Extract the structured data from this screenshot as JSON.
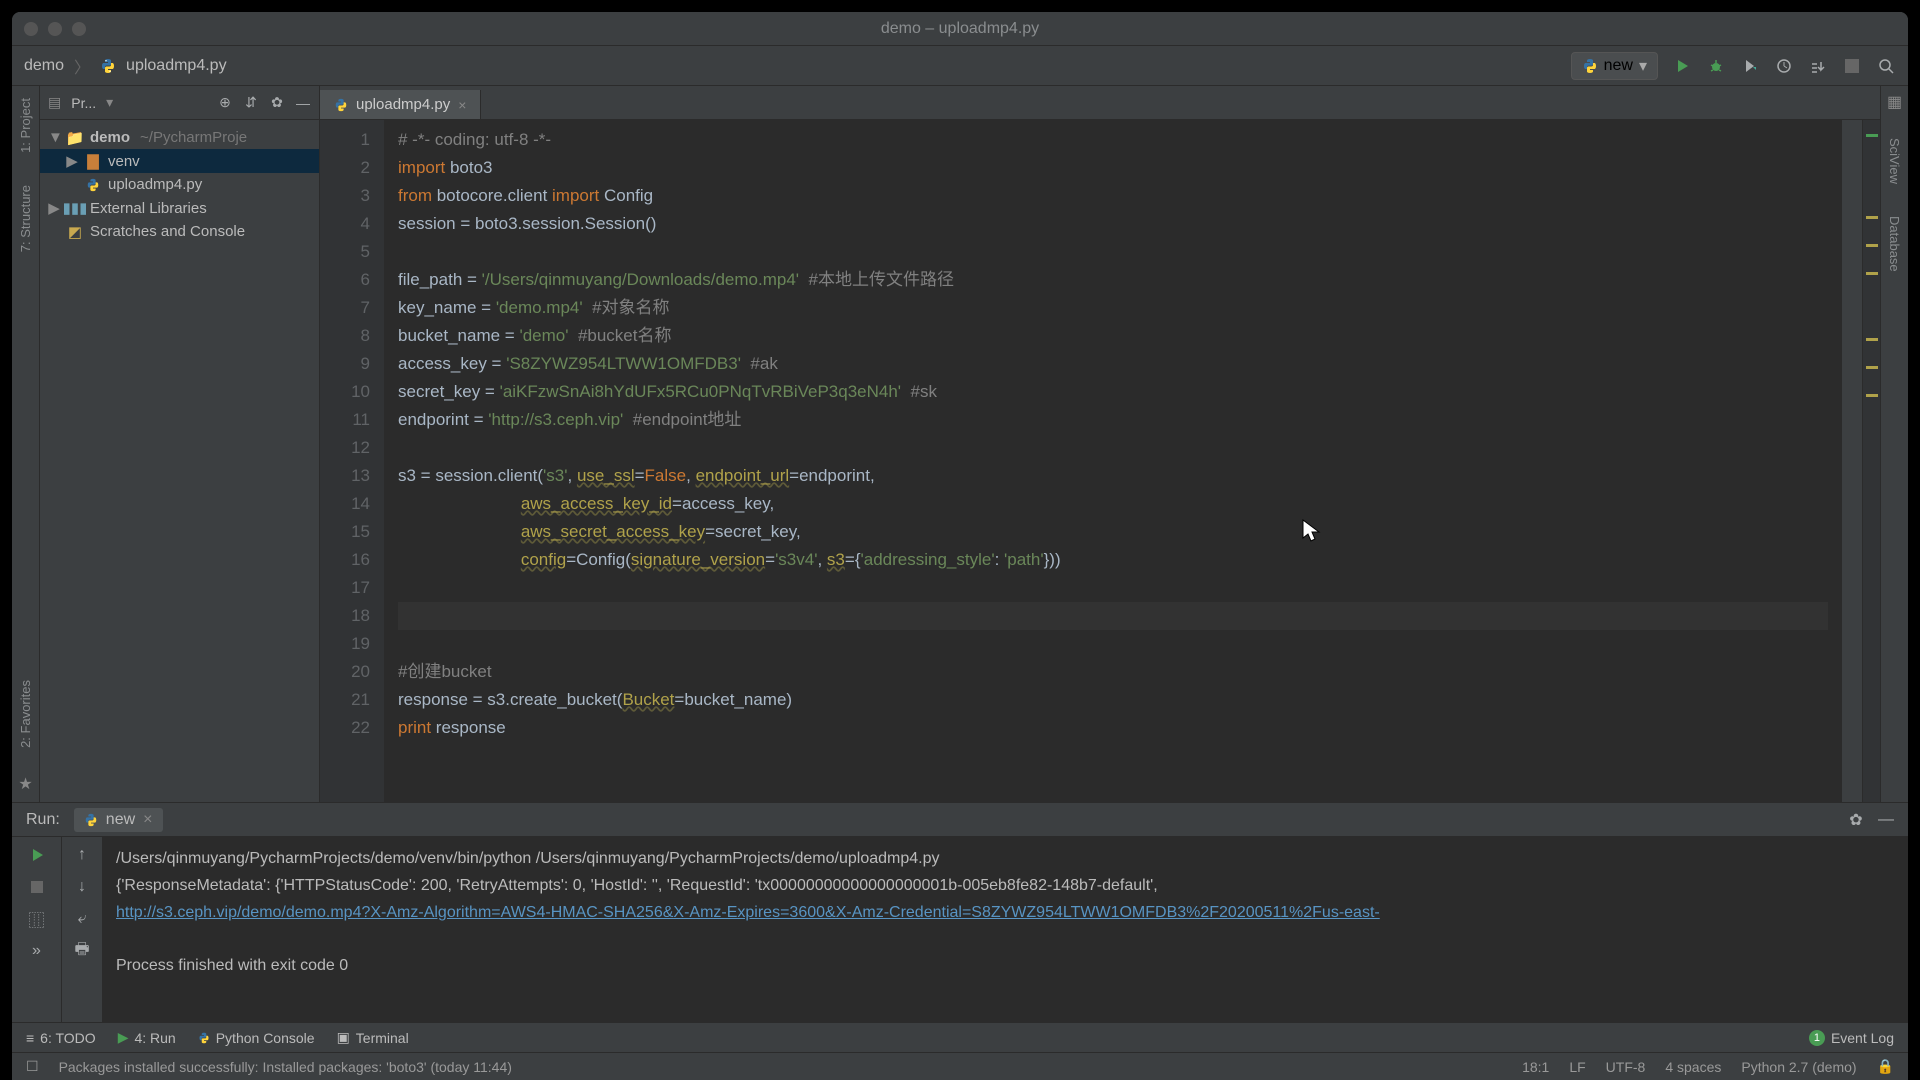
{
  "window_title": "demo – uploadmp4.py",
  "breadcrumbs": {
    "project": "demo",
    "file": "uploadmp4.py"
  },
  "run_config": "new",
  "project_panel": {
    "title": "Pr...",
    "tree": {
      "root": "demo",
      "root_path": "~/PycharmProje",
      "venv": "venv",
      "script": "uploadmp4.py",
      "ext_libs": "External Libraries",
      "scratches": "Scratches and Console"
    }
  },
  "tabs": [
    {
      "label": "uploadmp4.py"
    }
  ],
  "code": {
    "lines": [
      "# -*- coding: utf-8 -*-",
      "import boto3",
      "from botocore.client import Config",
      "session = boto3.session.Session()",
      "",
      "file_path = '/Users/qinmuyang/Downloads/demo.mp4'  #本地上传文件路径",
      "key_name = 'demo.mp4'  #对象名称",
      "bucket_name = 'demo'  #bucket名称",
      "access_key = 'S8ZYWZ954LTWW1OMFDB3'  #ak",
      "secret_key = 'aiKFzwSnAi8hYdUFx5RCu0PNqTvRBiVeP3q3eN4h'  #sk",
      "endporint = 'http://s3.ceph.vip'  #endpoint地址",
      "",
      "s3 = session.client('s3', use_ssl=False, endpoint_url=endporint,",
      "                          aws_access_key_id=access_key,",
      "                          aws_secret_access_key=secret_key,",
      "                          config=Config(signature_version='s3v4', s3={'addressing_style': 'path'}))",
      "",
      "",
      "#创建bucket",
      "response = s3.create_bucket(Bucket=bucket_name)",
      "print response",
      ""
    ]
  },
  "run_panel": {
    "label": "Run:",
    "tab": "new",
    "output_line1": "/Users/qinmuyang/PycharmProjects/demo/venv/bin/python /Users/qinmuyang/PycharmProjects/demo/uploadmp4.py",
    "output_line2": "{'ResponseMetadata': {'HTTPStatusCode': 200, 'RetryAttempts': 0, 'HostId': '', 'RequestId': 'tx00000000000000000001b-005eb8fe82-148b7-default',",
    "output_link": "http://s3.ceph.vip/demo/demo.mp4?X-Amz-Algorithm=AWS4-HMAC-SHA256&X-Amz-Expires=3600&X-Amz-Credential=S8ZYWZ954LTWW1OMFDB3%2F20200511%2Fus-east-",
    "output_exit": "Process finished with exit code 0"
  },
  "bottom_tabs": {
    "todo": "6: TODO",
    "run": "4: Run",
    "pyconsole": "Python Console",
    "terminal": "Terminal",
    "eventlog": "Event Log"
  },
  "status": {
    "message": "Packages installed successfully: Installed packages: 'boto3' (today 11:44)",
    "pos": "18:1",
    "lf": "LF",
    "enc": "UTF-8",
    "indent": "4 spaces",
    "sdk": "Python 2.7 (demo)"
  },
  "left_rail": {
    "project": "1: Project",
    "structure": "7: Structure",
    "favorites": "2: Favorites"
  },
  "right_rail": {
    "sciview": "SciView",
    "database": "Database"
  }
}
